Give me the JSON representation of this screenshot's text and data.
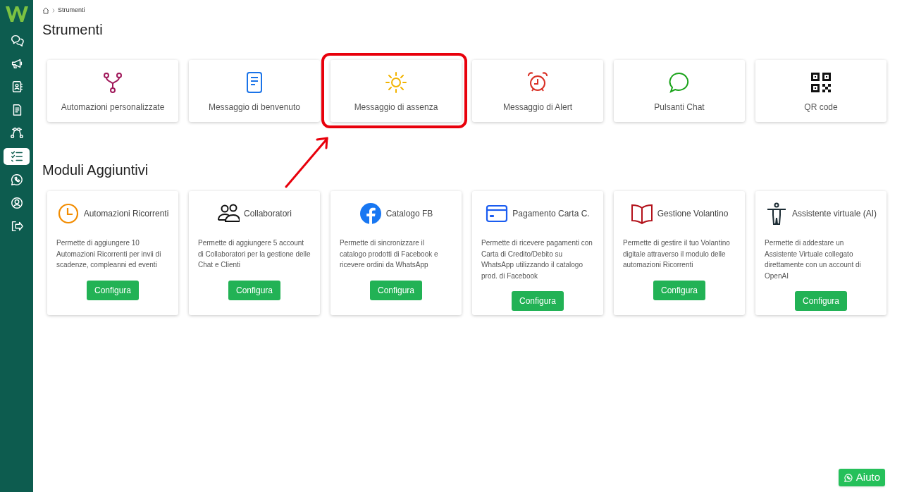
{
  "sidebar": {
    "items": [
      {
        "selected": false
      },
      {
        "selected": false
      },
      {
        "selected": false
      },
      {
        "selected": false
      },
      {
        "selected": false
      },
      {
        "selected": true
      },
      {
        "selected": false
      },
      {
        "selected": false
      },
      {
        "selected": false
      }
    ]
  },
  "breadcrumb": [
    "Strumenti"
  ],
  "title": "Strumenti",
  "tools": [
    {
      "label": "Automazioni personalizzate",
      "highlighted": false
    },
    {
      "label": "Messaggio di benvenuto",
      "highlighted": false
    },
    {
      "label": "Messaggio di assenza",
      "highlighted": true
    },
    {
      "label": "Messaggio di Alert",
      "highlighted": false
    },
    {
      "label": "Pulsanti Chat",
      "highlighted": false
    },
    {
      "label": "QR code",
      "highlighted": false
    }
  ],
  "modules_title": "Moduli Aggiuntivi",
  "modules": [
    {
      "title": "Automazioni Ricorrenti",
      "description": "Permette di aggiungere 10 Automazioni Ricorrenti per invii di scadenze, compleanni ed eventi",
      "button": "Configura"
    },
    {
      "title": "Collaboratori",
      "description": "Permette di aggiungere 5 account di Collaboratori per la gestione delle Chat e Clienti",
      "button": "Configura"
    },
    {
      "title": "Catalogo FB",
      "description": "Permette di sincronizzare il catalogo prodotti di Facebook e ricevere ordini da WhatsApp",
      "button": "Configura"
    },
    {
      "title": "Pagamento Carta C.",
      "description": "Permette di ricevere pagamenti con Carta di Credito/Debito su WhatsApp utilizzando il catalogo prod. di Facebook",
      "button": "Configura"
    },
    {
      "title": "Gestione Volantino",
      "description": "Permette di gestire il tuo Volantino digitale attraverso il modulo delle automazioni Ricorrenti",
      "button": "Configura"
    },
    {
      "title": "Assistente virtuale (AI)",
      "description": "Permette di addestare un Assistente Virtuale collegato direttamente con un account di OpenAI",
      "button": "Configura"
    }
  ],
  "help_button": "Aiuto"
}
